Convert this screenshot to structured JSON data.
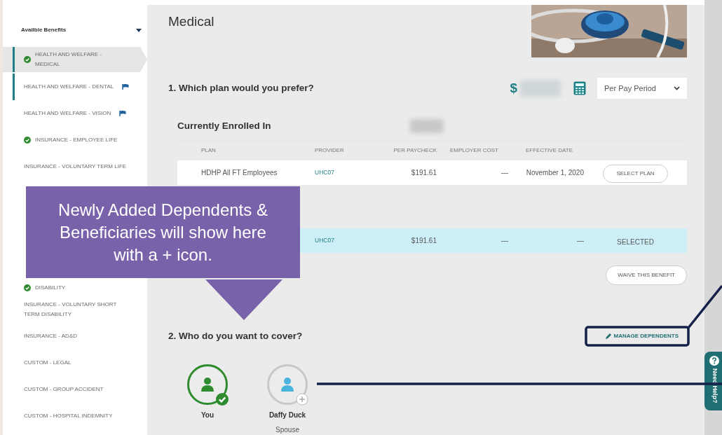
{
  "sidebar": {
    "title": "Availble Benefits",
    "items": [
      {
        "label": "HEALTH AND WELFARE - MEDICAL",
        "completed": true,
        "flagged": false,
        "accent": true,
        "selected": true,
        "kind": "full"
      },
      {
        "label": "HEALTH AND WELFARE - DENTAL",
        "completed": false,
        "flagged": true,
        "accent": true,
        "selected": false,
        "kind": "full"
      },
      {
        "label": "HEALTH AND WELFARE - VISION",
        "completed": false,
        "flagged": true,
        "accent": false,
        "selected": false,
        "kind": "full"
      },
      {
        "label": "INSURANCE - EMPLOYEE LIFE",
        "completed": true,
        "flagged": false,
        "accent": false,
        "selected": false,
        "kind": "full"
      },
      {
        "label": "INSURANCE - VOLUNTARY TERM LIFE",
        "completed": false,
        "flagged": false,
        "accent": false,
        "selected": false,
        "kind": "full"
      },
      {
        "label": "DISABILITY",
        "completed": true,
        "flagged": false,
        "accent": false,
        "selected": false,
        "kind": "partial"
      },
      {
        "label": "INSURANCE - VOLUNTARY SHORT TERM DISABILITY",
        "completed": false,
        "flagged": false,
        "accent": false,
        "selected": false,
        "kind": "full"
      },
      {
        "label": "INSURANCE - AD&D",
        "completed": false,
        "flagged": false,
        "accent": false,
        "selected": false,
        "kind": "full"
      },
      {
        "label": "CUSTOM - LEGAL",
        "completed": false,
        "flagged": false,
        "accent": false,
        "selected": false,
        "kind": "full"
      },
      {
        "label": "CUSTOM - GROUP ACCIDENT",
        "completed": false,
        "flagged": false,
        "accent": false,
        "selected": false,
        "kind": "full"
      },
      {
        "label": "CUSTOM - HOSPITAL INDEMNITY",
        "completed": false,
        "flagged": false,
        "accent": false,
        "selected": false,
        "kind": "full"
      }
    ]
  },
  "main": {
    "title": "Medical",
    "question1": "1. Which plan would you prefer?",
    "currency_symbol": "$",
    "period_select": {
      "value": "Per Pay Period"
    },
    "enrolled_label": "Currently Enrolled In",
    "table": {
      "columns": [
        "PLAN",
        "PROVIDER",
        "PER PAYCHECK",
        "EMPLOYER COST",
        "EFFECTIVE DATE"
      ],
      "rows": [
        {
          "plan": "HDHP All FT Employees",
          "provider": "UHC07",
          "per_paycheck": "$191.61",
          "employer_cost": "—",
          "effective_date": "November 1, 2020",
          "action": {
            "kind": "button",
            "label": "SELECT PLAN"
          },
          "selected": false
        },
        {
          "provider": "UHC07",
          "per_paycheck": "$191.61",
          "employer_cost": "—",
          "effective_date": "—",
          "action": {
            "kind": "text",
            "label": "SELECTED"
          },
          "selected": true
        }
      ]
    },
    "waive_button": "WAIVE THIS BENEFIT",
    "question2": "2. Who do you want to cover?",
    "manage_link": "MANAGE DEPENDENTS",
    "people": [
      {
        "name": "You",
        "covered": true
      },
      {
        "name": "Daffy Duck",
        "relation": "Spouse",
        "covered": false
      }
    ]
  },
  "callout": {
    "lines": [
      "Newly Added Dependents &",
      "Beneficiaries will show here",
      "with a + icon."
    ]
  },
  "help_tab": {
    "label": "Need Help?"
  }
}
